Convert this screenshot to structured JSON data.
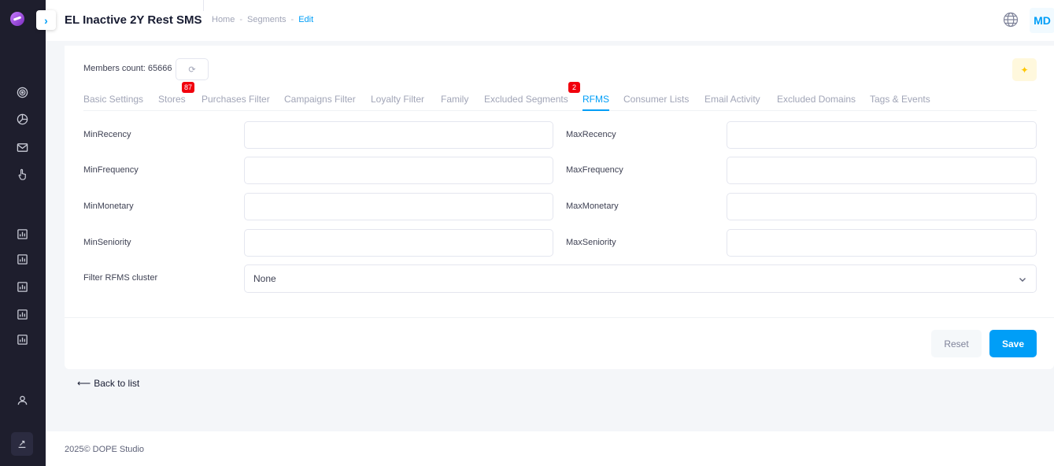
{
  "header": {
    "title": "EL Inactive 2Y Rest SMS",
    "breadcrumb": [
      "Home",
      "Segments",
      "Edit"
    ],
    "breadcrumb_sep": "-",
    "avatar_initials": "MD"
  },
  "card": {
    "members_label": "Members count: 65666",
    "tabs": [
      {
        "label": "Basic Settings"
      },
      {
        "label": "Stores",
        "badge": "87"
      },
      {
        "label": "Purchases Filter"
      },
      {
        "label": "Campaigns Filter"
      },
      {
        "label": "Loyalty Filter"
      },
      {
        "label": "Family"
      },
      {
        "label": "Excluded Segments",
        "badge": "2"
      },
      {
        "label": "RFMS",
        "active": true
      },
      {
        "label": "Consumer Lists"
      },
      {
        "label": "Email Activity"
      },
      {
        "label": "Excluded Domains"
      },
      {
        "label": "Tags & Events"
      }
    ],
    "fields": {
      "min_recency": {
        "label": "MinRecency",
        "value": ""
      },
      "max_recency": {
        "label": "MaxRecency",
        "value": ""
      },
      "min_frequency": {
        "label": "MinFrequency",
        "value": ""
      },
      "max_frequency": {
        "label": "MaxFrequency",
        "value": ""
      },
      "min_monetary": {
        "label": "MinMonetary",
        "value": ""
      },
      "max_monetary": {
        "label": "MaxMonetary",
        "value": ""
      },
      "min_seniority": {
        "label": "MinSeniority",
        "value": ""
      },
      "max_seniority": {
        "label": "MaxSeniority",
        "value": ""
      },
      "cluster": {
        "label": "Filter RFMS cluster",
        "value": "None"
      }
    },
    "buttons": {
      "reset": "Reset",
      "save": "Save"
    }
  },
  "back_link": "Back to list",
  "footer": {
    "text": "2025© DOPE Studio"
  },
  "colors": {
    "accent": "#009ef7",
    "sidebar": "#1e1e2d",
    "badge": "#f1000d"
  }
}
